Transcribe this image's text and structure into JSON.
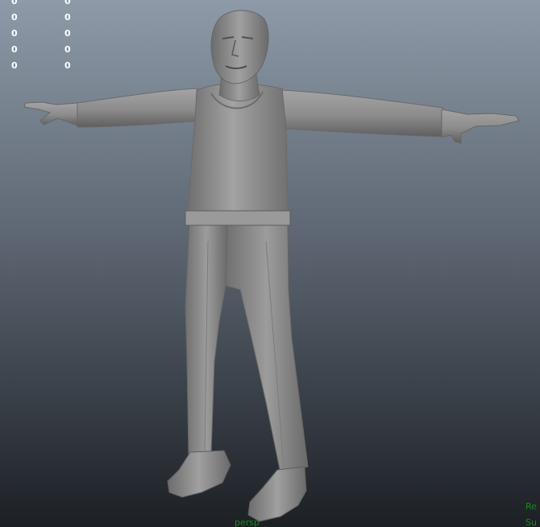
{
  "viewport": {
    "background_top": "#8c98a6",
    "background_bottom": "#1f2328",
    "model_color": "#8a8a8a",
    "model_shadow": "#555555",
    "camera_label": "persp",
    "corner_labels": [
      "Re",
      "Su"
    ]
  },
  "hud_stats": {
    "rows": [
      {
        "a": "0",
        "b": "0"
      },
      {
        "a": "0",
        "b": "0"
      },
      {
        "a": "0",
        "b": "0"
      },
      {
        "a": "0",
        "b": "0"
      },
      {
        "a": "0",
        "b": "0"
      }
    ],
    "color": "#ffffff"
  },
  "subject": "character-model-t-pose"
}
